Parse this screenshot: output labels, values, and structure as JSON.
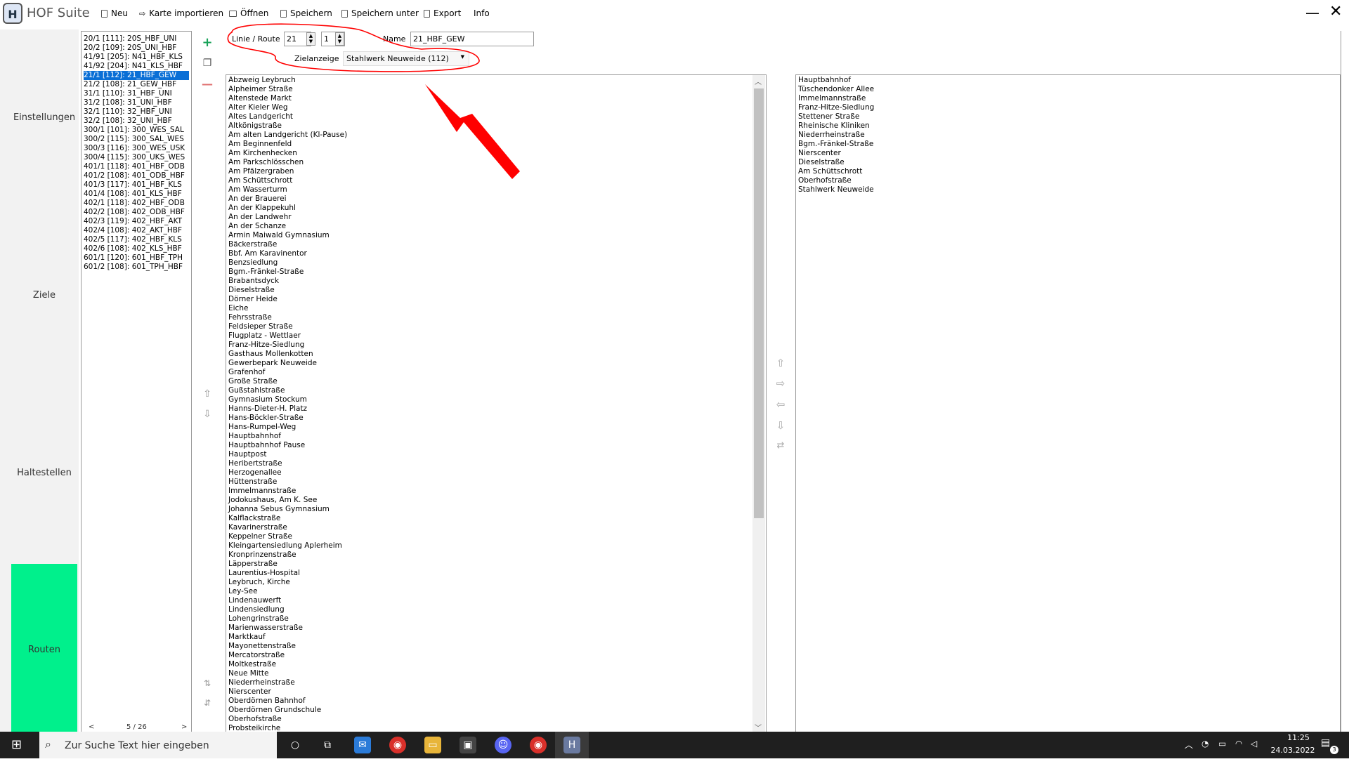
{
  "app": {
    "title": "HOF Suite",
    "logo_letter": "H"
  },
  "menu": {
    "neu": "Neu",
    "karte_importieren": "Karte importieren",
    "oeffnen": "Öffnen",
    "speichern": "Speichern",
    "speichern_unter": "Speichern unter",
    "export": "Export",
    "info": "Info"
  },
  "window_controls": {
    "minimize": "—",
    "close": "✕"
  },
  "nav": {
    "einstellungen": "Einstellungen",
    "ziele": "Ziele",
    "haltestellen": "Haltestellen",
    "routen": "Routen"
  },
  "routes": [
    "20/1 [111]: 20S_HBF_UNI",
    "20/2 [109]: 20S_UNI_HBF",
    "41/91 [205]: N41_HBF_KLS",
    "41/92 [204]: N41_KLS_HBF",
    "21/1 [112]: 21_HBF_GEW",
    "21/2 [108]: 21_GEW_HBF",
    "31/1 [110]: 31_HBF_UNI",
    "31/2 [108]: 31_UNI_HBF",
    "32/1 [110]: 32_HBF_UNI",
    "32/2 [108]: 32_UNI_HBF",
    "300/1 [101]: 300_WES_SAL",
    "300/2 [115]: 300_SAL_WES",
    "300/3 [116]: 300_WES_USK",
    "300/4 [115]: 300_UKS_WES",
    "401/1 [118]: 401_HBF_ODB",
    "401/2 [108]: 401_ODB_HBF",
    "401/3 [117]: 401_HBF_KLS",
    "401/4 [108]: 401_KLS_HBF",
    "402/1 [118]: 402_HBF_ODB",
    "402/2 [108]: 402_ODB_HBF",
    "402/3 [119]: 402_HBF_AKT",
    "402/4 [108]: 402_AKT_HBF",
    "402/5 [117]: 402_HBF_KLS",
    "402/6 [108]: 402_KLS_HBF",
    "601/1 [120]: 601_HBF_TPH",
    "601/2 [108]: 601_TPH_HBF"
  ],
  "routes_selected_index": 4,
  "routes_pager": {
    "prev": "<",
    "page": "5 / 26",
    "next": ">"
  },
  "form": {
    "linie_route_label": "Linie / Route",
    "linie_value": "21",
    "route_value": "1",
    "name_label": "Name",
    "name_value": "21_HBF_GEW",
    "zielanzeige_label": "Zielanzeige",
    "zielanzeige_value": "Stahlwerk Neuweide (112)"
  },
  "all_stops": [
    "Abzweig Leybruch",
    "Alpheimer Straße",
    "Altenstede Markt",
    "Alter Kieler Weg",
    "Altes Landgericht",
    "Altkönigstraße",
    "Am alten Landgericht (Kl-Pause)",
    "Am Beginnenfeld",
    "Am Kirchenhecken",
    "Am Parkschlösschen",
    "Am Pfälzergraben",
    "Am Schüttschrott",
    "Am Wasserturm",
    "An der Brauerei",
    "An der Klappekuhl",
    "An der Landwehr",
    "An der Schanze",
    "Armin Maiwald Gymnasium",
    "Bäckerstraße",
    "Bbf. Am Karavinentor",
    "Benzsiedlung",
    "Bgm.-Fränkel-Straße",
    "Brabantsdyck",
    "Dieselstraße",
    "Dörner Heide",
    "Eiche",
    "Fehrsstraße",
    "Feldsieper Straße",
    "Flugplatz - Wettlaer",
    "Franz-Hitze-Siedlung",
    "Gasthaus Mollenkotten",
    "Gewerbepark Neuweide",
    "Grafenhof",
    "Große Straße",
    "Gußstahlstraße",
    "Gymnasium Stockum",
    "Hanns-Dieter-H. Platz",
    "Hans-Böckler-Straße",
    "Hans-Rumpel-Weg",
    "Hauptbahnhof",
    "Hauptbahnhof Pause",
    "Hauptpost",
    "Heribertstraße",
    "Herzogenallee",
    "Hüttenstraße",
    "Immelmannstraße",
    "Jodokushaus, Am K. See",
    "Johanna Sebus Gymnasium",
    "Kalflackstraße",
    "Kavarinerstraße",
    "Keppelner Straße",
    "Kleingartensiedlung Aplerheim",
    "Kronprinzenstraße",
    "Läpperstraße",
    "Laurentius-Hospital",
    "Leybruch, Kirche",
    "Ley-See",
    "Lindenauwerft",
    "Lindensiedlung",
    "Lohengrinstraße",
    "Marienwasserstraße",
    "Marktkauf",
    "Mayonettenstraße",
    "Mercatorstraße",
    "Moltkestraße",
    "Neue Mitte",
    "Niederrheinstraße",
    "Nierscenter",
    "Oberdörnen Bahnhof",
    "Oberdörnen Grundschule",
    "Oberhofstraße",
    "Probsteikirche"
  ],
  "route_stops": [
    "Hauptbahnhof",
    "Tüschendonker Allee",
    "Immelmannstraße",
    "Franz-Hitze-Siedlung",
    "Stettener Straße",
    "Rheinische Kliniken",
    "Niederrheinstraße",
    "Bgm.-Fränkel-Straße",
    "Nierscenter",
    "Dieselstraße",
    "Am Schüttschrott",
    "Oberhofstraße",
    "Stahlwerk Neuweide"
  ],
  "taskbar": {
    "search_placeholder": "Zur Suche Text hier eingeben",
    "time": "11:25",
    "date": "24.03.2022",
    "notification_count": "3"
  },
  "colors": {
    "nav_active": "#00f08c",
    "selection": "#0a6fd6",
    "annotation": "#ff0000",
    "taskbar": "#1f1f1f"
  }
}
